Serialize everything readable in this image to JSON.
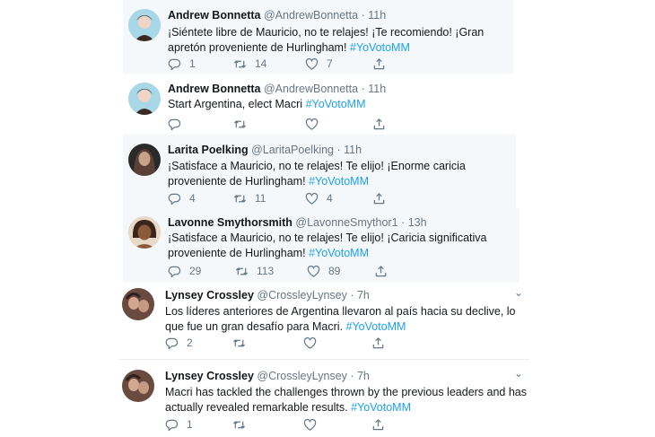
{
  "tweets": [
    {
      "name": "Andrew Bonnetta",
      "handle": "@AndrewBonnetta",
      "time": "11h",
      "text": "¡Siéntete libre de Mauricio, no te relajes! ¡Te recomiendo! ¡Gran apretón proveniente de Hurlingham!",
      "hashtag": "#YoVotoMM",
      "replies": "1",
      "retweets": "14",
      "likes": "7",
      "avatar_colors": [
        "#a8d8e8",
        "#3a2a22",
        "#f2d4c4"
      ]
    },
    {
      "name": "Andrew Bonnetta",
      "handle": "@AndrewBonnetta",
      "time": "11h",
      "text": "Start Argentina, elect Macri",
      "hashtag": "#YoVotoMM",
      "replies": "",
      "retweets": "",
      "likes": "",
      "avatar_colors": [
        "#a8d8e8",
        "#3a2a22",
        "#f2d4c4"
      ]
    },
    {
      "name": "Larita Poelking",
      "handle": "@LaritaPoelking",
      "time": "11h",
      "text": "¡Satisface a Mauricio, no te relajes! Te elijo! ¡Enorme caricia proveniente de Hurlingham!",
      "hashtag": "#YoVotoMM",
      "replies": "4",
      "retweets": "11",
      "likes": "4",
      "avatar_colors": [
        "#2a2a2a",
        "#5a4036",
        "#c9a28a"
      ]
    },
    {
      "name": "Lavonne Smythorsmith",
      "handle": "@LavonneSmythor1",
      "time": "13h",
      "text": "¡Satisface a Mauricio, no te relajes! Te elijo! ¡Caricia significativa proveniente de Hurlingham!",
      "hashtag": "#YoVotoMM",
      "replies": "29",
      "retweets": "113",
      "likes": "89",
      "avatar_colors": [
        "#e8d8c8",
        "#3b2418",
        "#8a5a3a"
      ]
    },
    {
      "name": "Lynsey Crossley",
      "handle": "@CrossleyLynsey",
      "time": "7h",
      "text": "Los líderes anteriores de Argentina llevaron al país hacia su declive, lo que fue un gran desafío para Macri.",
      "hashtag": "#YoVotoMM",
      "replies": "2",
      "retweets": "",
      "likes": "",
      "avatar_colors": [
        "#6a4a3e",
        "#d4a890",
        "#2e2020"
      ]
    },
    {
      "name": "Lynsey Crossley",
      "handle": "@CrossleyLynsey",
      "time": "7h",
      "text": "Macri has tackled the challenges thrown by the previous leaders and has actually revealed remarkable results.",
      "hashtag": "#YoVotoMM",
      "replies": "1",
      "retweets": "",
      "likes": "",
      "avatar_colors": [
        "#6a4a3e",
        "#d4a890",
        "#2e2020"
      ]
    }
  ],
  "colors": {
    "accent": "#1da1f2",
    "muted": "#657786",
    "text": "#14171a"
  },
  "icons": [
    "reply-icon",
    "retweet-icon",
    "like-icon",
    "share-icon",
    "more-icon"
  ],
  "more_glyph": "⌄"
}
